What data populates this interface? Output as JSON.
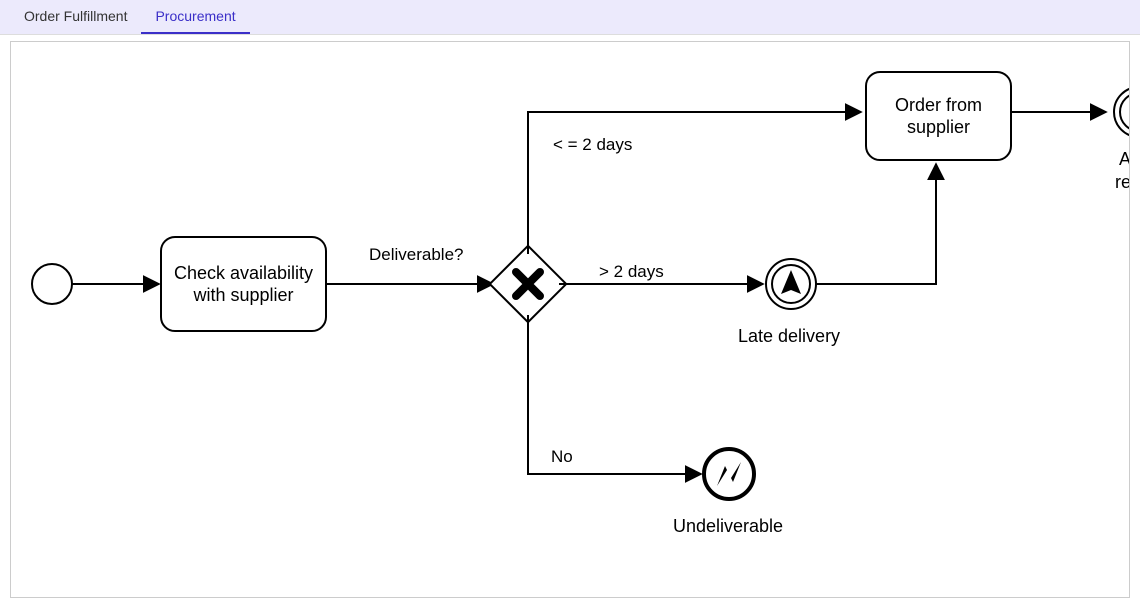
{
  "tabs": {
    "items": [
      {
        "label": "Order Fulfillment"
      },
      {
        "label": "Procurement"
      }
    ],
    "activeIndex": 1
  },
  "nodes": {
    "task_check": "Check availability with supplier",
    "task_order": "Order from supplier",
    "event_late": "Late delivery",
    "event_undeliverable": "Undeliverable",
    "event_article_partial1": "A",
    "event_article_partial2": "re"
  },
  "edges": {
    "gateway_label": "Deliverable?",
    "branch_fast": "< = 2 days",
    "branch_slow": "> 2 days",
    "branch_no": "No"
  }
}
